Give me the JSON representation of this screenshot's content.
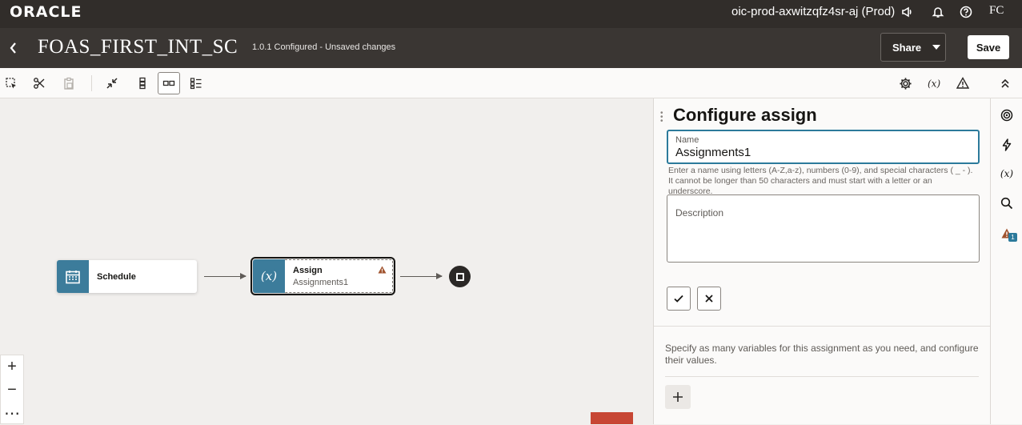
{
  "header": {
    "logo": "ORACLE",
    "environment": "oic-prod-axwitzqfz4sr-aj (Prod)",
    "avatar_initials": "FC"
  },
  "title_bar": {
    "integration_name": "FOAS_FIRST_INT_SC",
    "version_status": "1.0.1 Configured - Unsaved changes",
    "share_label": "Share",
    "save_label": "Save"
  },
  "toolbar": {
    "icons": [
      "select-icon",
      "cut-icon",
      "paste-icon",
      "collapse-icon",
      "vertical-layout-icon",
      "horizontal-layout-icon",
      "pseudo-view-icon",
      "settings-icon",
      "tracking-icon",
      "warning-icon",
      "collapse-up-icon"
    ]
  },
  "canvas": {
    "nodes": [
      {
        "title": "Schedule",
        "subtitle": "",
        "icon": "calendar-icon"
      },
      {
        "title": "Assign",
        "subtitle": "Assignments1",
        "icon": "variable-icon",
        "selected": true,
        "warning": true
      }
    ],
    "zoom_controls": [
      "+",
      "−",
      "⋯"
    ]
  },
  "panel": {
    "title": "Configure assign",
    "name_label": "Name",
    "name_value": "Assignments1",
    "name_help": "Enter a name using letters (A-Z,a-z), numbers (0-9), and special characters ( _ - ). It cannot be longer than 50 characters and must start with a letter or an underscore.",
    "description_label": "Description",
    "assign_help": "Specify as many variables for this assignment as you need, and configure their values."
  },
  "rail": {
    "items": [
      "target-icon",
      "lightning-icon",
      "variable-icon",
      "search-icon",
      "warning-icon"
    ],
    "warning_count": "1"
  },
  "colors": {
    "header_bg": "#312d2a",
    "node_icon_bg": "#3c7c9b",
    "focus_border": "#2c7a9b",
    "warning": "#c74634"
  }
}
